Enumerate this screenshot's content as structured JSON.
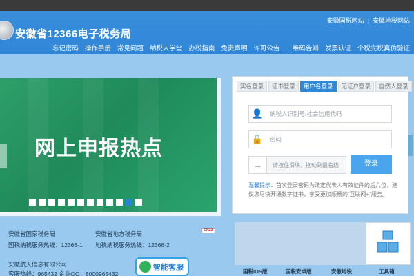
{
  "header": {
    "site_title": "安徽省12366电子税务局",
    "top_links": [
      "安徽国税网站",
      "安徽地税网站"
    ],
    "top_link_sep": "|",
    "nav": [
      "忘记密码",
      "操作手册",
      "常见问题",
      "纳税人学堂",
      "办税指南",
      "免责声明",
      "许可公告",
      "二维码告知",
      "发票认证",
      "个税完税真伪验证"
    ]
  },
  "banner": {
    "headline": "网上申报热点",
    "next_arrow": "›",
    "dot_count": 12,
    "active_dot": 10
  },
  "login": {
    "tabs": [
      "实名登录",
      "证书登录",
      "用户名登录",
      "无证户登录",
      "自然人登录"
    ],
    "active_tab": 2,
    "user_placeholder": "纳税人识别号/社会信用代码",
    "password_placeholder": "密码",
    "slider_text": "请按住滑块，拖动到最右边",
    "slider_arrow": "→",
    "login_button": "登录",
    "tip_label": "温馨提示：",
    "tip_text": "首次登录密码为法定代表人有效证件的后六位，建议您尽快开通数字证书，享受更加顺畅的“互联网+”服务。"
  },
  "footer": {
    "nat_name": "安徽省国家税务局",
    "nat_hotline": "国税纳税服务热线：12366-1",
    "local_name": "安徽省地方税务局",
    "local_hotline": "地税纳税服务热线：12366-2",
    "company": "安徽航天信息有限公司",
    "contact": "客服热线：965432   企业QQ：8000965432",
    "cnzz": "CNZZ",
    "service_button": "智能客服"
  },
  "apps": [
    "国税IOS版",
    "国税安卓版",
    "安徽地税",
    "工具箱"
  ],
  "colors": {
    "header": "#2f86d8",
    "band": "#9ac9ef",
    "banner": "#1f8a5a",
    "accent": "#2f87d8"
  }
}
